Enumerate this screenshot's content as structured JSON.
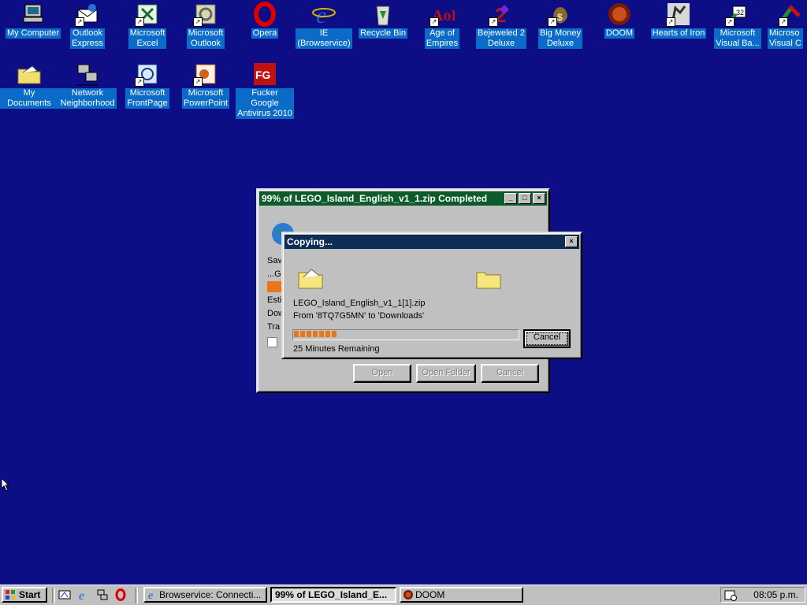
{
  "desktop": {
    "icons": [
      {
        "label": "My Computer",
        "icon": "computer-icon"
      },
      {
        "label": "Outlook\nExpress",
        "icon": "outlook-express-icon"
      },
      {
        "label": "Microsoft\nExcel",
        "icon": "excel-icon"
      },
      {
        "label": "Microsoft\nOutlook",
        "icon": "outlook-icon"
      },
      {
        "label": "Opera",
        "icon": "opera-icon"
      },
      {
        "label": "IE\n(Browservice)",
        "icon": "ie-icon"
      },
      {
        "label": "Recycle Bin",
        "icon": "recycle-bin-icon"
      },
      {
        "label": "Age of\nEmpires",
        "icon": "age-of-empires-icon"
      },
      {
        "label": "Bejeweled 2\nDeluxe",
        "icon": "bejeweled-icon"
      },
      {
        "label": "Big Money\nDeluxe",
        "icon": "big-money-icon"
      },
      {
        "label": "DOOM",
        "icon": "doom-icon"
      },
      {
        "label": "Hearts of Iron",
        "icon": "hearts-of-iron-icon"
      },
      {
        "label": "Microsoft\nVisual Ba...",
        "icon": "visual-basic-icon"
      },
      {
        "label": "Microso\nVisual C",
        "icon": "visual-c-icon"
      },
      {
        "label": "My Documents",
        "icon": "my-documents-icon"
      },
      {
        "label": "Network\nNeighborhood",
        "icon": "network-icon"
      },
      {
        "label": "Microsoft\nFrontPage",
        "icon": "frontpage-icon"
      },
      {
        "label": "Microsoft\nPowerPoint",
        "icon": "powerpoint-icon"
      },
      {
        "label": "Fucker Google\nAntivirus 2010",
        "icon": "antivirus-icon"
      }
    ]
  },
  "download_window": {
    "title": "99% of LEGO_Island_English_v1_1.zip Completed",
    "partial_lines": [
      "Sav",
      "...Gi",
      "Esti",
      "Dow",
      "Tra"
    ],
    "buttons": {
      "open": "Open",
      "open_folder": "Open Folder",
      "cancel": "Cancel"
    }
  },
  "copy_dialog": {
    "title": "Copying...",
    "filename": "LEGO_Island_English_v1_1[1].zip",
    "from_to": "From '8TQ7G5MN' to 'Downloads'",
    "remaining": "25 Minutes Remaining",
    "cancel_label": "Cancel",
    "progress_fraction": 0.2
  },
  "taskbar": {
    "start_label": "Start",
    "tasks": [
      {
        "label": "Browservice: Connecti..."
      },
      {
        "label": "99% of LEGO_Island_E..."
      },
      {
        "label": "DOOM"
      }
    ],
    "clock": "08:05 p.m."
  },
  "colors": {
    "desktop": "#0d0d86",
    "progress": "#e8771c",
    "label_highlight": "#0b6bc9"
  }
}
